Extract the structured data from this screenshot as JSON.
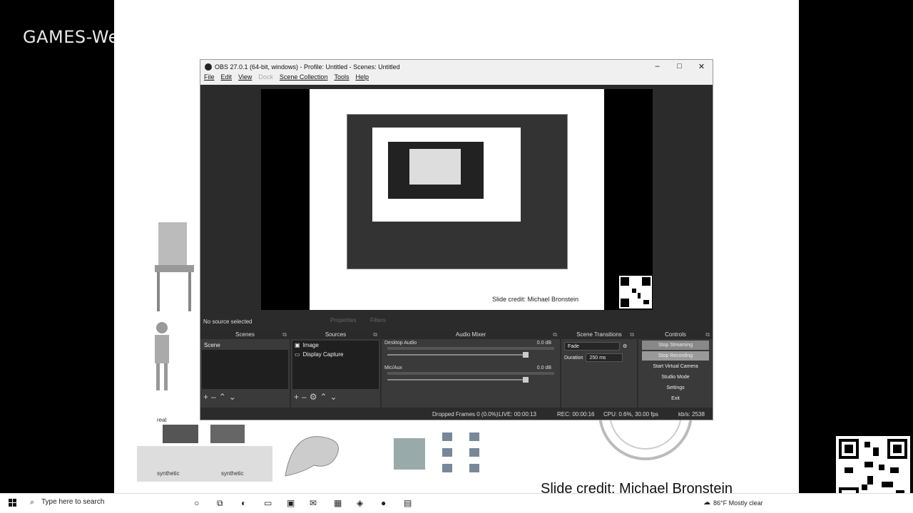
{
  "background": {
    "watermark": "GAMES-We",
    "slide_credit": "Slide credit: Michael Bronstein",
    "labels": [
      "real",
      "synthetic",
      "synthetic"
    ]
  },
  "obs": {
    "title": "OBS 27.0.1 (64-bit, windows) - Profile: Untitled - Scenes: Untitled",
    "window_controls": [
      "–",
      "□",
      "✕"
    ],
    "menu": [
      "File",
      "Edit",
      "View",
      "Dock",
      "Scene Collection",
      "Tools",
      "Help"
    ],
    "preview": {
      "credit": "Slide credit: Michael Bronstein"
    },
    "source_status": "No source selected",
    "properties_label": "Properties",
    "filters_label": "Filters",
    "docks": {
      "scenes": {
        "title": "Scenes",
        "items": [
          "Scene"
        ]
      },
      "sources": {
        "title": "Sources",
        "items": [
          "Image",
          "Display Capture"
        ]
      },
      "mixer": {
        "title": "Audio Mixer",
        "channels": [
          {
            "name": "Desktop Audio",
            "db": "0.0 dB"
          },
          {
            "name": "Mic/Aux",
            "db": "0.0 dB"
          }
        ]
      },
      "transitions": {
        "title": "Scene Transitions",
        "type": "Fade",
        "duration_label": "Duration",
        "duration_value": "250 ms"
      },
      "controls": {
        "title": "Controls",
        "buttons": [
          "Stop Streaming",
          "Stop Recording",
          "Start Virtual Camera",
          "Studio Mode",
          "Settings",
          "Exit"
        ]
      }
    },
    "statusbar": {
      "dropped": "Dropped Frames 0 (0.0%)",
      "live": "LIVE: 00:00:13",
      "rec": "REC: 00:00:16",
      "cpu": "CPU: 0.6%, 30.00 fps",
      "kbps": "kb/s: 2538"
    }
  },
  "taskbar": {
    "search_placeholder": "Type here to search",
    "weather": "86°F  Mostly clear"
  },
  "colors": {
    "obs_bg": "#2b2b2b",
    "dock_bg": "#3a3a3a",
    "list_bg": "#1f1f1f",
    "active_button": "#888888"
  }
}
